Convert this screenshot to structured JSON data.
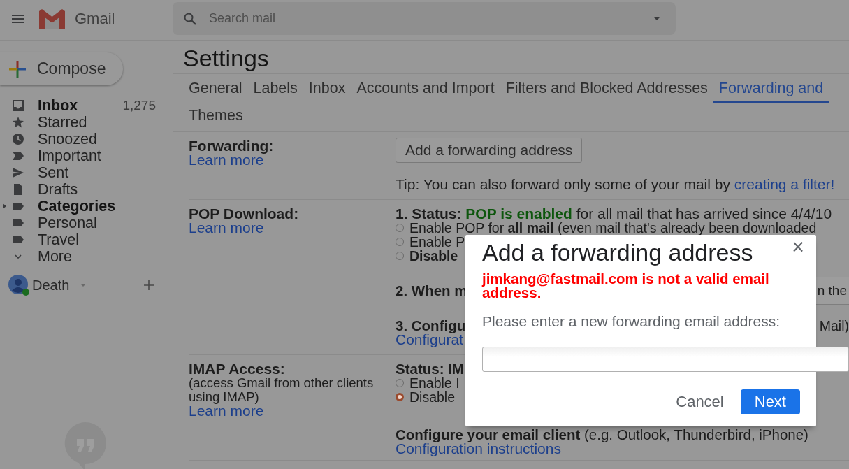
{
  "header": {
    "app_name": "Gmail",
    "search": {
      "placeholder": "Search mail"
    }
  },
  "sidebar": {
    "compose": "Compose",
    "items": [
      {
        "kind": "inbox",
        "label": "Inbox",
        "count": "1,275",
        "bold": true
      },
      {
        "kind": "star",
        "label": "Starred",
        "bold": false
      },
      {
        "kind": "clock",
        "label": "Snoozed",
        "bold": false
      },
      {
        "kind": "important",
        "label": "Important",
        "bold": false
      },
      {
        "kind": "sent",
        "label": "Sent",
        "bold": false
      },
      {
        "kind": "draft",
        "label": "Drafts",
        "bold": false
      },
      {
        "kind": "label",
        "label": "Categories",
        "bold": true,
        "expanded": false
      },
      {
        "kind": "label",
        "label": "Personal",
        "bold": false
      },
      {
        "kind": "label",
        "label": "Travel",
        "bold": false
      },
      {
        "kind": "more",
        "label": "More",
        "bold": false
      }
    ],
    "account": {
      "name": "Death",
      "online": true
    }
  },
  "settings": {
    "title": "Settings",
    "tabs": [
      {
        "label": "General",
        "selected": false
      },
      {
        "label": "Labels",
        "selected": false
      },
      {
        "label": "Inbox",
        "selected": false
      },
      {
        "label": "Accounts and Import",
        "selected": false
      },
      {
        "label": "Filters and Blocked Addresses",
        "selected": false
      },
      {
        "label": "Forwarding and",
        "selected": true
      },
      {
        "label": "Themes",
        "selected": false
      }
    ],
    "sections": [
      {
        "title": "Forwarding:",
        "learn_more": "Learn more",
        "items": [
          {
            "kind": "button",
            "text": "Add a forwarding address"
          },
          {
            "kind": "tip",
            "text": "Tip: You can also forward only some of your mail by",
            "link": "creating a filter!"
          }
        ]
      },
      {
        "title": "POP Download:",
        "learn_more": "Learn more",
        "items": [
          {
            "kind": "status",
            "label": "1. Status:",
            "highlight": "POP is enabled",
            "rest": "for all mail that has arrived since 4/4/10"
          },
          {
            "kind": "radio",
            "text": "Enable POP for **all mail** (even mail that's already been downloaded",
            "selected": false
          },
          {
            "kind": "radio",
            "text": "Enable P",
            "selected": false
          },
          {
            "kind": "radio",
            "text": "**Disable**",
            "selected": false
          },
          {
            "kind": "heading",
            "text": "**2. When m**",
            "right": {
              "kind": "select",
              "text": "n the"
            }
          },
          {
            "kind": "heading",
            "text": "**3. Configu**",
            "right": {
              "kind": "text",
              "text": "Mail)"
            }
          },
          {
            "kind": "link",
            "text": "Configurat"
          }
        ]
      },
      {
        "title": "IMAP Access:",
        "note": "(access Gmail from other clients using IMAP)",
        "learn_more": "Learn more",
        "items": [
          {
            "kind": "heading",
            "text": "**Status: IM**"
          },
          {
            "kind": "radio",
            "text": "Enable I",
            "selected": false
          },
          {
            "kind": "radio",
            "text": "Disable",
            "selected": true
          },
          {
            "kind": "heading",
            "text": "**Configure your email client** (e.g. Outlook, Thunderbird, iPhone)"
          },
          {
            "kind": "link",
            "text": "Configuration instructions"
          }
        ]
      }
    ]
  },
  "dialog": {
    "title": "Add a forwarding address",
    "close": "×",
    "error": "jimkang@fastmail.com is not a valid email address.",
    "prompt": "Please enter a new forwarding email address:",
    "buttons": [
      {
        "label": "Cancel",
        "primary": false
      },
      {
        "label": "Next",
        "primary": true
      }
    ]
  }
}
